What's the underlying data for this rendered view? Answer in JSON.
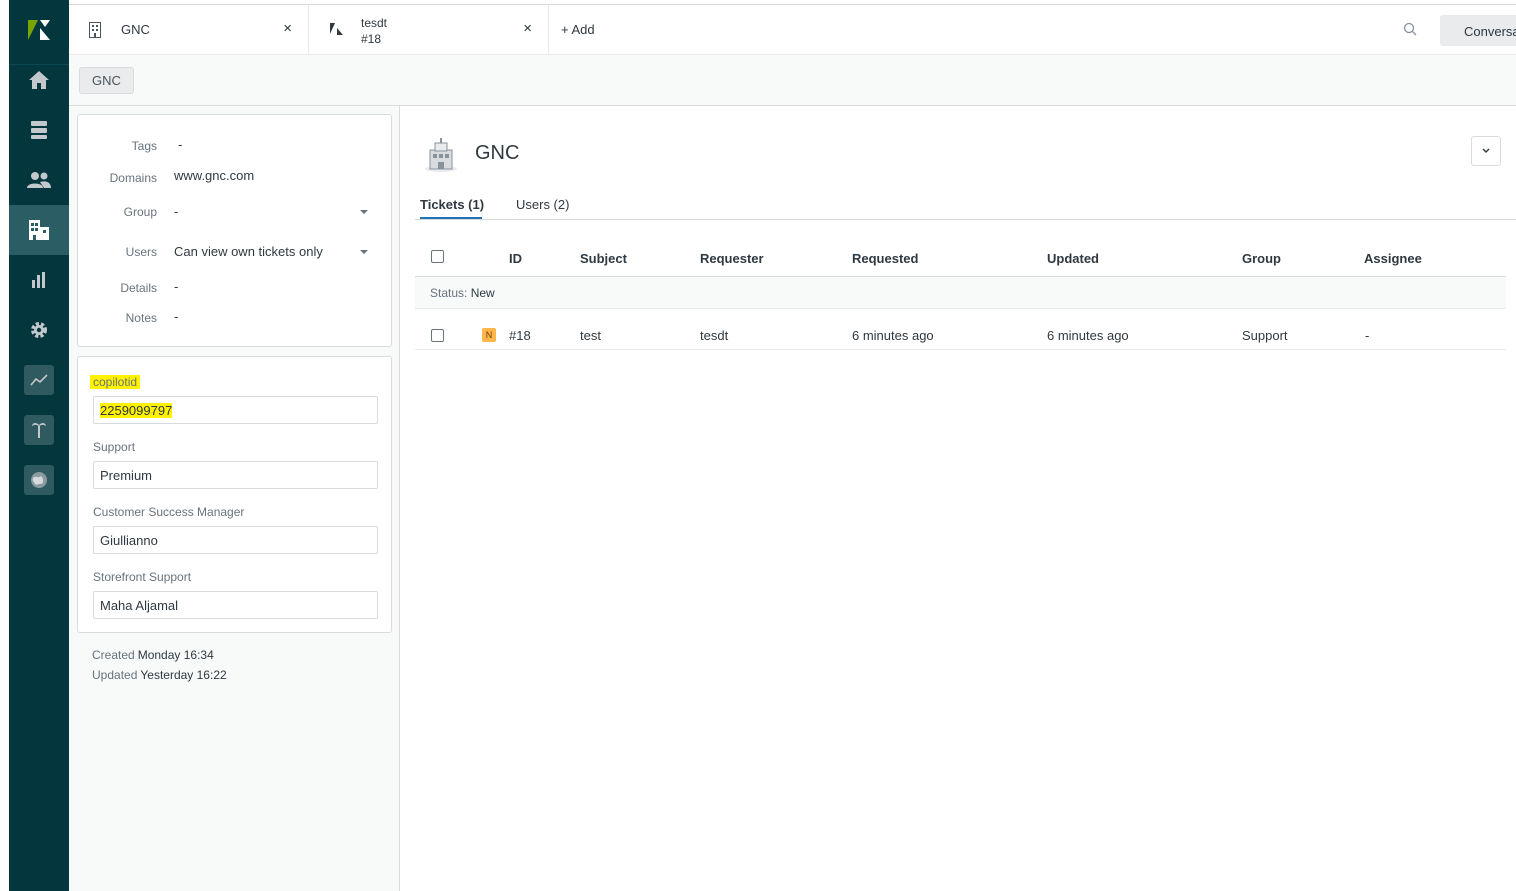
{
  "top_tabs": [
    {
      "title": "GNC",
      "close": "×"
    },
    {
      "title_line1": "tesdt",
      "title_line2": "#18",
      "close": "×"
    }
  ],
  "add_tab_label": "+ Add",
  "conversations_label": "Conversations",
  "breadcrumb": "GNC",
  "properties": {
    "tags_label": "Tags",
    "tags_value": "-",
    "domains_label": "Domains",
    "domains_value": "www.gnc.com",
    "group_label": "Group",
    "group_value": "-",
    "users_label": "Users",
    "users_value": "Can view own tickets only",
    "details_label": "Details",
    "details_value": "-",
    "notes_label": "Notes",
    "notes_value": "-"
  },
  "fields": [
    {
      "label": "copilotid",
      "value": "2259099797"
    },
    {
      "label": "Support",
      "value": "Premium"
    },
    {
      "label": "Customer Success Manager",
      "value": "Giullianno"
    },
    {
      "label": "Storefront Support",
      "value": "Maha Aljamal"
    }
  ],
  "meta": {
    "created_label": "Created",
    "created_value": "Monday 16:34",
    "updated_label": "Updated",
    "updated_value": "Yesterday 16:22"
  },
  "org": {
    "title": "GNC"
  },
  "main_tabs": {
    "tickets": "Tickets (1)",
    "users": "Users (2)"
  },
  "table": {
    "headers": [
      "ID",
      "Subject",
      "Requester",
      "Requested",
      "Updated",
      "Group",
      "Assignee"
    ],
    "group_key": "Status:",
    "group_value": "New",
    "rows": [
      {
        "status": "N",
        "id": "#18",
        "subject": "test",
        "requester": "tesdt",
        "requested": "6 minutes ago",
        "updated": "6 minutes ago",
        "group": "Support",
        "assignee": "-"
      }
    ]
  },
  "colors": {
    "sidebar": "#03363d",
    "accent": "#1f73b7",
    "status_new": "#ffb648",
    "highlight": "#fff200"
  }
}
